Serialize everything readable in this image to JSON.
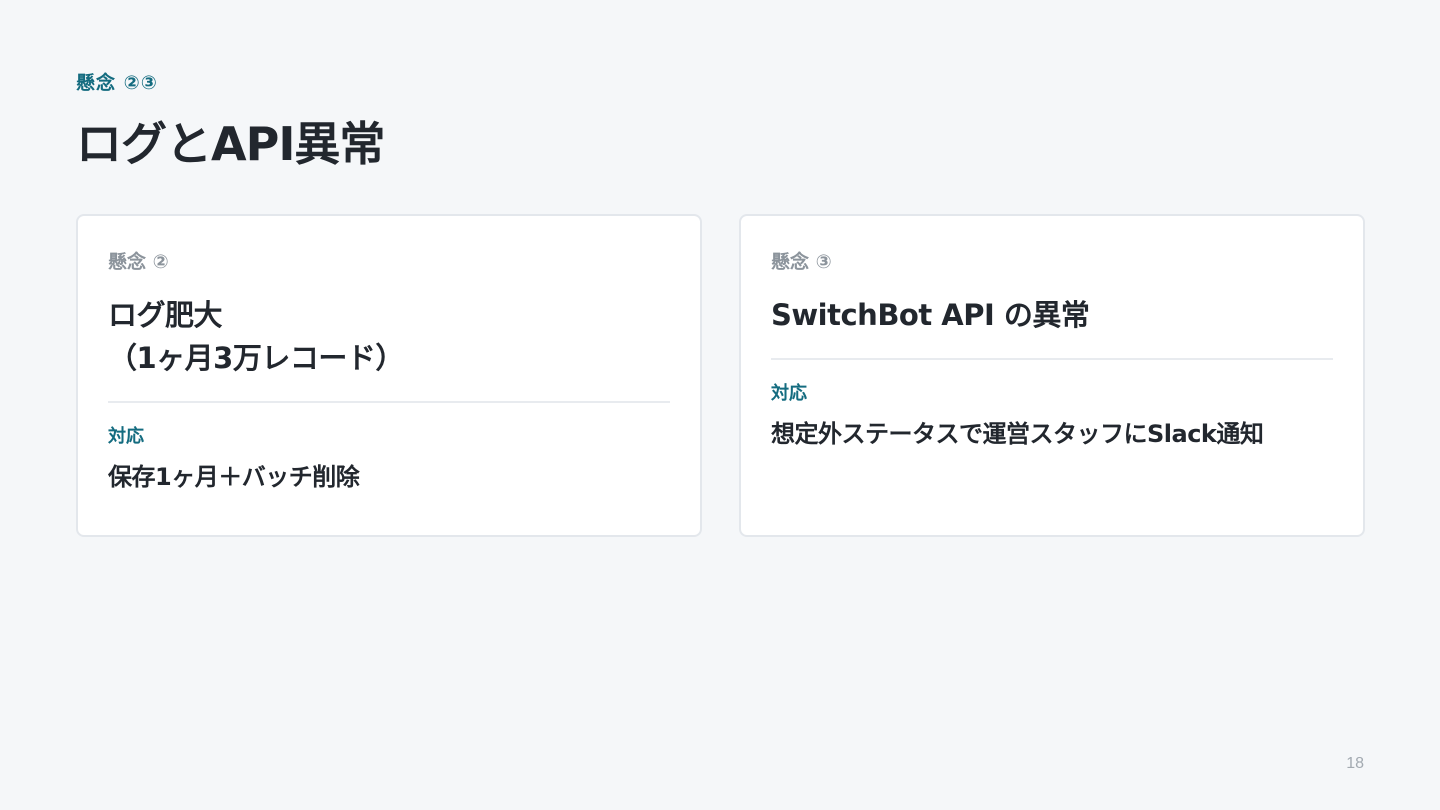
{
  "header": {
    "eyebrow": "懸念 ②③",
    "title": "ログとAPI異常"
  },
  "cards": [
    {
      "label": "懸念 ②",
      "heading": "ログ肥大\n（1ヶ月3万レコード）",
      "response_label": "対応",
      "response_text": "保存1ヶ月＋バッチ削除"
    },
    {
      "label": "懸念 ③",
      "heading": "SwitchBot API の異常",
      "response_label": "対応",
      "response_text": "想定外ステータスで運営スタッフにSlack通知"
    }
  ],
  "footer": {
    "page_number": "18"
  },
  "colors": {
    "background": "#f5f7f9",
    "accent": "#146c80",
    "text": "#22272e",
    "muted": "#8c949c"
  }
}
